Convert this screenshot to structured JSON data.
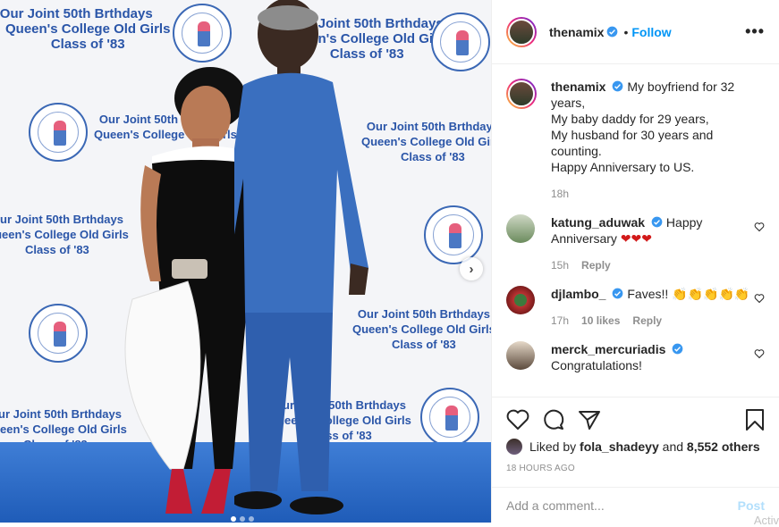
{
  "banner": {
    "line1": "Our Joint 50th Brthdays",
    "line2": "Queen's College Old Girls",
    "line3": "Class of '83"
  },
  "carousel": {
    "slide_count": 3,
    "active_index": 0
  },
  "post": {
    "username": "thenamix",
    "follow_label": "Follow",
    "separator": "•",
    "caption": {
      "line1": "My boyfriend for 32 years,",
      "line2": "My baby daddy for 29 years,",
      "line3": "My husband for 30 years and counting.",
      "line4": "Happy Anniversary to US."
    },
    "caption_time": "18h"
  },
  "comments": [
    {
      "username": "katung_aduwak",
      "text": "Happy Anniversary",
      "emoji": "❤❤❤",
      "time": "15h",
      "reply": "Reply"
    },
    {
      "username": "djlambo_",
      "text": "Faves!!",
      "emoji": "👏👏👏👏👏",
      "time": "17h",
      "likes": "10 likes",
      "reply": "Reply"
    },
    {
      "username": "merck_mercuriadis",
      "text": "Congratulations!"
    }
  ],
  "likes": {
    "liked_by": "Liked by",
    "user": "fola_shadeyy",
    "and": "and",
    "others": "8,552 others"
  },
  "timestamp": "18 HOURS AGO",
  "add_comment": {
    "placeholder": "Add a comment...",
    "post_label": "Post"
  },
  "watermark": "Activ",
  "colors": {
    "accent": "#0095f6",
    "verified": "#3897f0",
    "floor": "#2a6bc9",
    "banner_text": "#2a55a8"
  }
}
